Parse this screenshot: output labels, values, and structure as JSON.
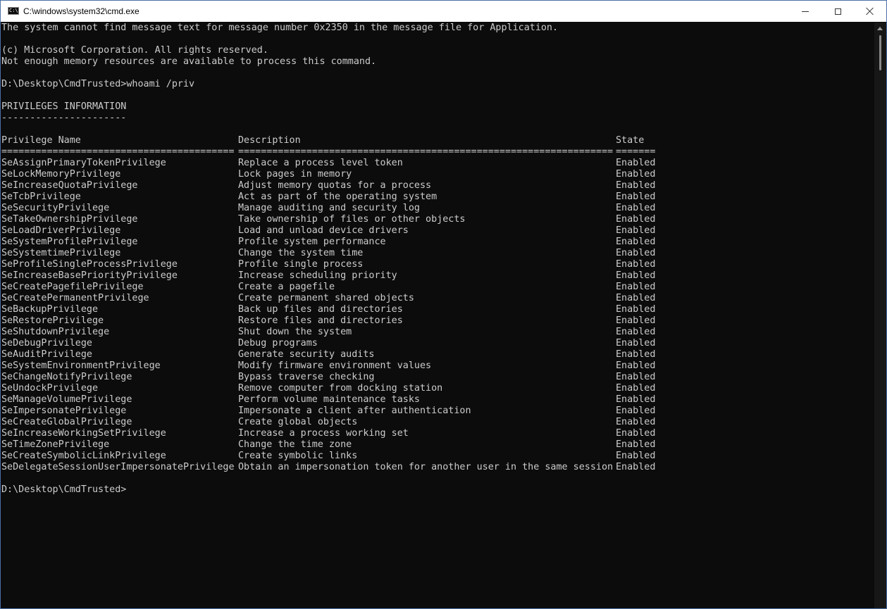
{
  "window": {
    "title": "C:\\windows\\system32\\cmd.exe",
    "icon_label": "C:\\."
  },
  "console": {
    "lines": [
      "The system cannot find message text for message number 0x2350 in the message file for Application.",
      "",
      "(c) Microsoft Corporation. All rights reserved.",
      "Not enough memory resources are available to process this command.",
      "",
      "D:\\Desktop\\CmdTrusted>whoami /priv",
      "",
      "PRIVILEGES INFORMATION",
      "----------------------"
    ],
    "table": {
      "headers": [
        "Privilege Name",
        "Description",
        "State"
      ],
      "separators": [
        "=========================================",
        "==================================================================",
        "======="
      ],
      "rows": [
        [
          "SeAssignPrimaryTokenPrivilege",
          "Replace a process level token",
          "Enabled"
        ],
        [
          "SeLockMemoryPrivilege",
          "Lock pages in memory",
          "Enabled"
        ],
        [
          "SeIncreaseQuotaPrivilege",
          "Adjust memory quotas for a process",
          "Enabled"
        ],
        [
          "SeTcbPrivilege",
          "Act as part of the operating system",
          "Enabled"
        ],
        [
          "SeSecurityPrivilege",
          "Manage auditing and security log",
          "Enabled"
        ],
        [
          "SeTakeOwnershipPrivilege",
          "Take ownership of files or other objects",
          "Enabled"
        ],
        [
          "SeLoadDriverPrivilege",
          "Load and unload device drivers",
          "Enabled"
        ],
        [
          "SeSystemProfilePrivilege",
          "Profile system performance",
          "Enabled"
        ],
        [
          "SeSystemtimePrivilege",
          "Change the system time",
          "Enabled"
        ],
        [
          "SeProfileSingleProcessPrivilege",
          "Profile single process",
          "Enabled"
        ],
        [
          "SeIncreaseBasePriorityPrivilege",
          "Increase scheduling priority",
          "Enabled"
        ],
        [
          "SeCreatePagefilePrivilege",
          "Create a pagefile",
          "Enabled"
        ],
        [
          "SeCreatePermanentPrivilege",
          "Create permanent shared objects",
          "Enabled"
        ],
        [
          "SeBackupPrivilege",
          "Back up files and directories",
          "Enabled"
        ],
        [
          "SeRestorePrivilege",
          "Restore files and directories",
          "Enabled"
        ],
        [
          "SeShutdownPrivilege",
          "Shut down the system",
          "Enabled"
        ],
        [
          "SeDebugPrivilege",
          "Debug programs",
          "Enabled"
        ],
        [
          "SeAuditPrivilege",
          "Generate security audits",
          "Enabled"
        ],
        [
          "SeSystemEnvironmentPrivilege",
          "Modify firmware environment values",
          "Enabled"
        ],
        [
          "SeChangeNotifyPrivilege",
          "Bypass traverse checking",
          "Enabled"
        ],
        [
          "SeUndockPrivilege",
          "Remove computer from docking station",
          "Enabled"
        ],
        [
          "SeManageVolumePrivilege",
          "Perform volume maintenance tasks",
          "Enabled"
        ],
        [
          "SeImpersonatePrivilege",
          "Impersonate a client after authentication",
          "Enabled"
        ],
        [
          "SeCreateGlobalPrivilege",
          "Create global objects",
          "Enabled"
        ],
        [
          "SeIncreaseWorkingSetPrivilege",
          "Increase a process working set",
          "Enabled"
        ],
        [
          "SeTimeZonePrivilege",
          "Change the time zone",
          "Enabled"
        ],
        [
          "SeCreateSymbolicLinkPrivilege",
          "Create symbolic links",
          "Enabled"
        ],
        [
          "SeDelegateSessionUserImpersonatePrivilege",
          "Obtain an impersonation token for another user in the same session",
          "Enabled"
        ]
      ]
    },
    "prompt": "D:\\Desktop\\CmdTrusted>"
  },
  "icons": {
    "app": "console-app-icon",
    "minimize": "minimize-icon",
    "maximize": "maximize-icon",
    "close": "close-icon",
    "scroll_up": "scroll-up-arrow-icon"
  },
  "colors": {
    "console_bg": "#0c0c0c",
    "console_fg": "#cccccc",
    "titlebar_bg": "#ffffff",
    "scrollbar_bg": "#171717"
  }
}
